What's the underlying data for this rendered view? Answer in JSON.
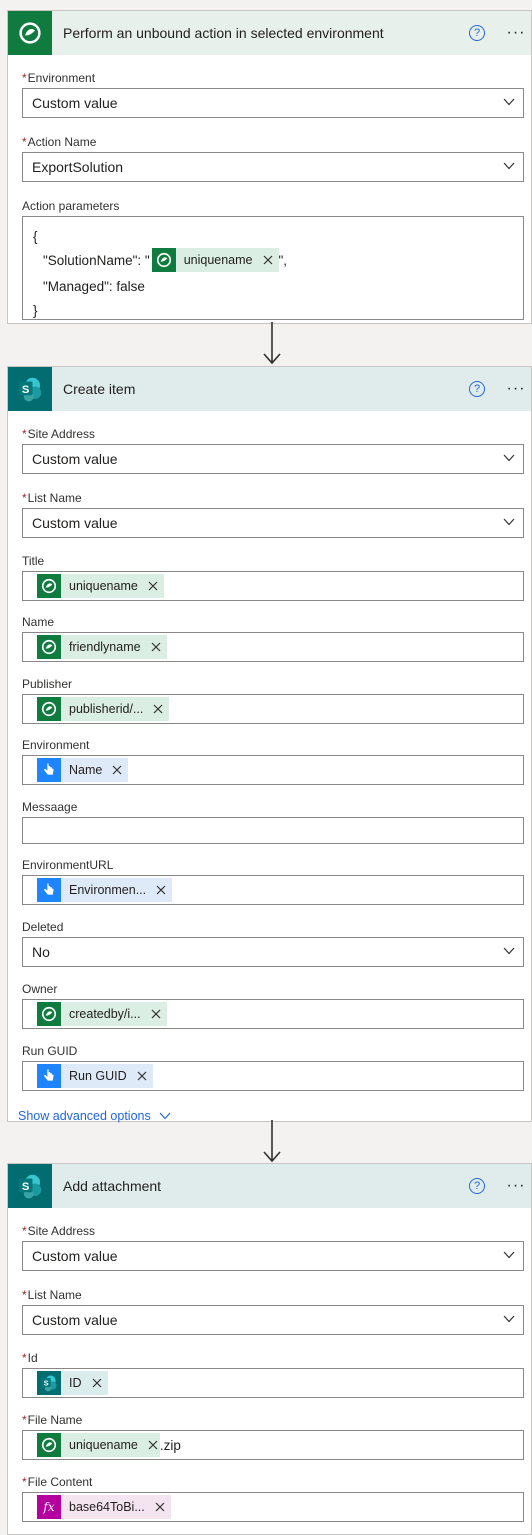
{
  "card1": {
    "title": "Perform an unbound action in selected environment",
    "help": "?",
    "more": "···",
    "environment": {
      "label": "Environment",
      "value": "Custom value"
    },
    "action_name": {
      "label": "Action Name",
      "value": "ExportSolution"
    },
    "action_params": {
      "label": "Action parameters",
      "line1": "{",
      "line2_prefix": "\"SolutionName\": \"",
      "line2_token": "uniquename",
      "line2_suffix": "\",",
      "line3": "\"Managed\": false",
      "line4": "}"
    }
  },
  "card2": {
    "title": "Create item",
    "help": "?",
    "more": "···",
    "site_address": {
      "label": "Site Address",
      "value": "Custom value"
    },
    "list_name": {
      "label": "List Name",
      "value": "Custom value"
    },
    "title_field": {
      "label": "Title",
      "token": "uniquename"
    },
    "name_field": {
      "label": "Name",
      "token": "friendlyname"
    },
    "publisher": {
      "label": "Publisher",
      "token": "publisherid/..."
    },
    "environment": {
      "label": "Environment",
      "token": "Name"
    },
    "message": {
      "label": "Messaage",
      "value": ""
    },
    "environment_url": {
      "label": "EnvironmentURL",
      "token": "Environmen..."
    },
    "deleted": {
      "label": "Deleted",
      "value": "No"
    },
    "owner": {
      "label": "Owner",
      "token": "createdby/i..."
    },
    "run_guid": {
      "label": "Run GUID",
      "token": "Run GUID"
    },
    "advanced": "Show advanced options"
  },
  "card3": {
    "title": "Add attachment",
    "help": "?",
    "more": "···",
    "site_address": {
      "label": "Site Address",
      "value": "Custom value"
    },
    "list_name": {
      "label": "List Name",
      "value": "Custom value"
    },
    "id": {
      "label": "Id",
      "token": "ID"
    },
    "file_name": {
      "label": "File Name",
      "token": "uniquename",
      "suffix": ".zip"
    },
    "file_content": {
      "label": "File Content",
      "token": "base64ToBi..."
    }
  },
  "required_marker": "*",
  "colors": {
    "dataverse": "#0f7b3f",
    "sharepoint": "#036c70",
    "manual": "#1f85ff",
    "expression": "#b4009e",
    "link": "#2266e3"
  },
  "icons": [
    "dataverse-icon",
    "sharepoint-icon",
    "manual-trigger-icon",
    "expression-icon",
    "help-icon",
    "more-icon",
    "chevron-down-icon",
    "close-icon",
    "arrow-down-icon"
  ]
}
